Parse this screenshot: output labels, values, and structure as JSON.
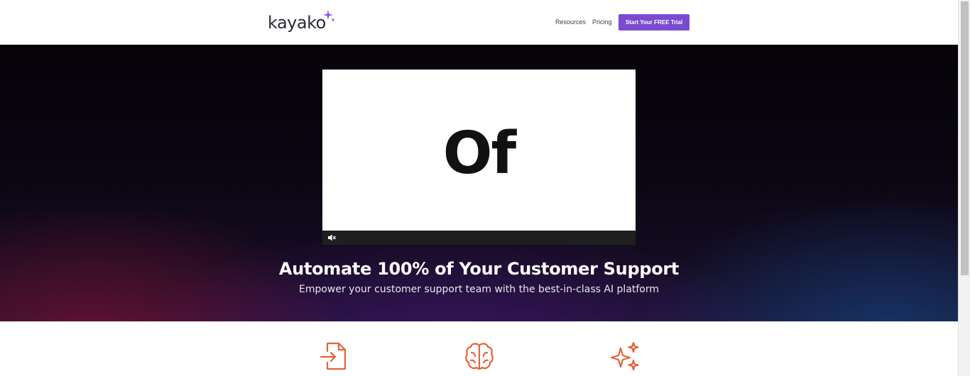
{
  "header": {
    "logo_text": "kayako",
    "nav": {
      "resources_label": "Resources",
      "pricing_label": "Pricing",
      "trial_label": "Start Your FREE Trial"
    }
  },
  "hero": {
    "video_word": "Of",
    "title": "Automate 100% of Your Customer Support",
    "subtitle": "Empower your customer support team with the best-in-class AI platform"
  },
  "features": {
    "icons": [
      "document-import-icon",
      "brain-icon",
      "sparkles-icon"
    ],
    "icon_color": "#e8613c"
  },
  "colors": {
    "accent": "#7a4bd0",
    "logo_spark": "#8a55e0"
  }
}
